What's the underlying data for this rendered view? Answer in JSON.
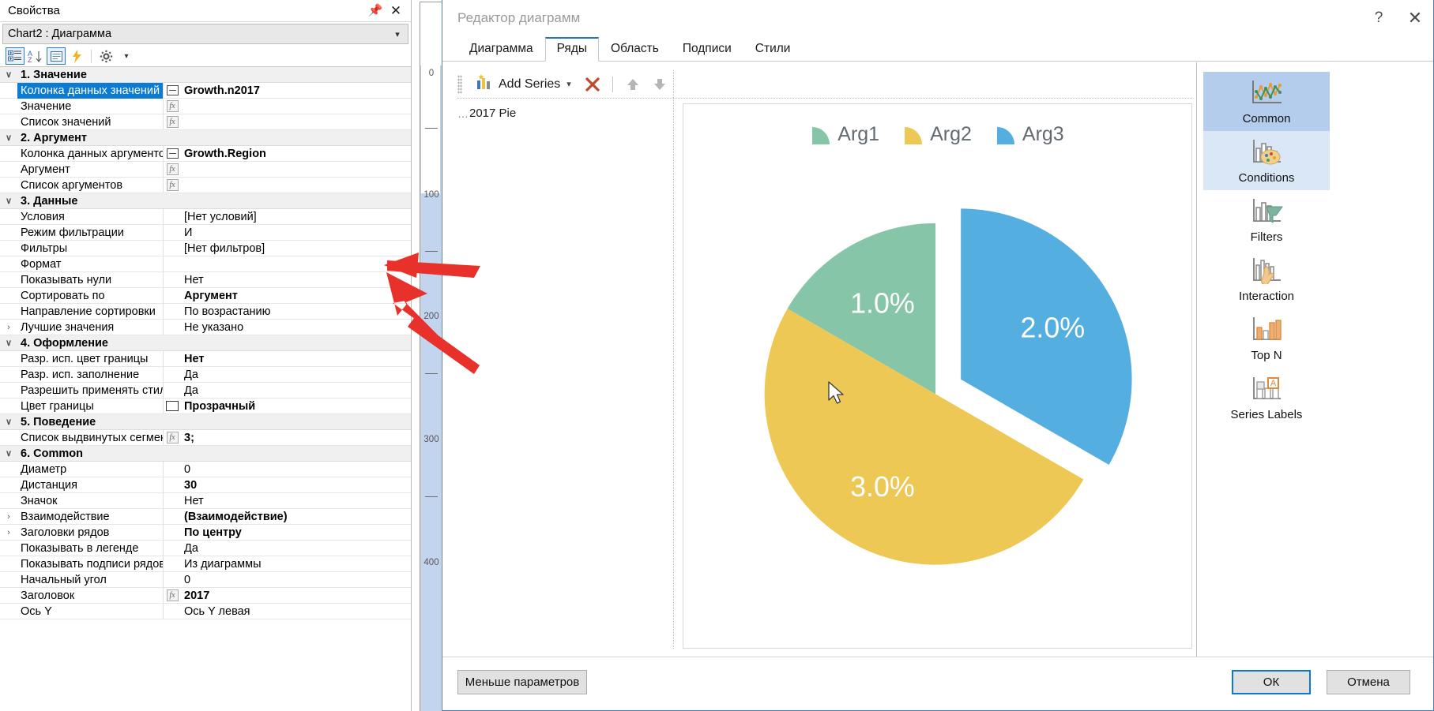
{
  "properties_panel": {
    "title": "Свойства",
    "pin_icon": "pin-icon",
    "close_icon": "close-icon",
    "object_selector": "Chart2 : Диаграмма",
    "toolbar": {
      "categorized_icon": "categorized-view-icon",
      "alphabetical_icon": "alphabetical-sort-icon",
      "pages_icon": "property-pages-icon",
      "events_icon": "events-lightning-icon",
      "settings_icon": "gear-icon",
      "settings_dropdown_icon": "chevron-down-icon"
    },
    "rows": [
      {
        "type": "group",
        "twisty": "v",
        "name": "1. Значение"
      },
      {
        "type": "prop",
        "twisty": "",
        "name": "Колонка данных значений",
        "badge": "column",
        "value": "Growth.n2017",
        "bold": true,
        "selected": true
      },
      {
        "type": "prop",
        "twisty": "",
        "name": "Значение",
        "badge": "fx",
        "value": "",
        "bold": false
      },
      {
        "type": "prop",
        "twisty": "",
        "name": "Список значений",
        "badge": "fx",
        "value": "",
        "bold": false
      },
      {
        "type": "group",
        "twisty": "v",
        "name": "2. Аргумент"
      },
      {
        "type": "prop",
        "twisty": "",
        "name": "Колонка данных аргументо",
        "badge": "column",
        "value": "Growth.Region",
        "bold": true
      },
      {
        "type": "prop",
        "twisty": "",
        "name": "Аргумент",
        "badge": "fx",
        "value": "",
        "bold": false
      },
      {
        "type": "prop",
        "twisty": "",
        "name": "Список аргументов",
        "badge": "fx",
        "value": "",
        "bold": false
      },
      {
        "type": "group",
        "twisty": "v",
        "name": "3. Данные"
      },
      {
        "type": "prop",
        "twisty": "",
        "name": "Условия",
        "badge": "",
        "value": "[Нет условий]",
        "bold": false
      },
      {
        "type": "prop",
        "twisty": "",
        "name": "Режим фильтрации",
        "badge": "",
        "value": "И",
        "bold": false
      },
      {
        "type": "prop",
        "twisty": "",
        "name": "Фильтры",
        "badge": "",
        "value": "[Нет фильтров]",
        "bold": false
      },
      {
        "type": "prop",
        "twisty": "",
        "name": "Формат",
        "badge": "",
        "value": "",
        "bold": false
      },
      {
        "type": "prop",
        "twisty": "",
        "name": "Показывать нули",
        "badge": "",
        "value": "Нет",
        "bold": false
      },
      {
        "type": "prop",
        "twisty": "",
        "name": "Сортировать по",
        "badge": "",
        "value": "Аргумент",
        "bold": true
      },
      {
        "type": "prop",
        "twisty": "",
        "name": "Направление сортировки",
        "badge": "",
        "value": "По возрастанию",
        "bold": false
      },
      {
        "type": "prop",
        "twisty": ">",
        "name": "Лучшие значения",
        "badge": "",
        "value": "Не указано",
        "bold": false
      },
      {
        "type": "group",
        "twisty": "v",
        "name": "4. Оформление"
      },
      {
        "type": "prop",
        "twisty": "",
        "name": "Разр. исп. цвет границы",
        "badge": "",
        "value": "Нет",
        "bold": true
      },
      {
        "type": "prop",
        "twisty": "",
        "name": "Разр. исп. заполнение",
        "badge": "",
        "value": "Да",
        "bold": false
      },
      {
        "type": "prop",
        "twisty": "",
        "name": "Разрешить применять стил",
        "badge": "",
        "value": "Да",
        "bold": false
      },
      {
        "type": "prop",
        "twisty": "",
        "name": "Цвет границы",
        "badge": "swatch",
        "value": "Прозрачный",
        "bold": true
      },
      {
        "type": "group",
        "twisty": "v",
        "name": "5. Поведение"
      },
      {
        "type": "prop",
        "twisty": "",
        "name": "Список выдвинутых сегмен",
        "badge": "fx",
        "value": "3;",
        "bold": true
      },
      {
        "type": "group",
        "twisty": "v",
        "name": "6. Common"
      },
      {
        "type": "prop",
        "twisty": "",
        "name": "Диаметр",
        "badge": "",
        "value": "0",
        "bold": false
      },
      {
        "type": "prop",
        "twisty": "",
        "name": "Дистанция",
        "badge": "",
        "value": "30",
        "bold": true
      },
      {
        "type": "prop",
        "twisty": "",
        "name": "Значок",
        "badge": "",
        "value": "Нет",
        "bold": false
      },
      {
        "type": "prop",
        "twisty": ">",
        "name": "Взаимодействие",
        "badge": "",
        "value": "(Взаимодействие)",
        "bold": true
      },
      {
        "type": "prop",
        "twisty": ">",
        "name": "Заголовки рядов",
        "badge": "",
        "value": "По центру",
        "bold": true
      },
      {
        "type": "prop",
        "twisty": "",
        "name": "Показывать в легенде",
        "badge": "",
        "value": "Да",
        "bold": false
      },
      {
        "type": "prop",
        "twisty": "",
        "name": "Показывать подписи рядов",
        "badge": "",
        "value": "Из диаграммы",
        "bold": false
      },
      {
        "type": "prop",
        "twisty": "",
        "name": "Начальный угол",
        "badge": "",
        "value": "0",
        "bold": false
      },
      {
        "type": "prop",
        "twisty": "",
        "name": "Заголовок",
        "badge": "fx",
        "value": "2017",
        "bold": true
      },
      {
        "type": "prop",
        "twisty": "",
        "name": "Ось Y",
        "badge": "",
        "value": "Ось Y левая",
        "bold": false
      }
    ]
  },
  "ruler": {
    "ticks": [
      "0",
      "100",
      "200",
      "300",
      "400"
    ]
  },
  "dialog": {
    "title": "Редактор диаграмм",
    "help_icon": "help-question-icon",
    "close_icon": "close-icon",
    "tabs": [
      {
        "label": "Диаграмма",
        "active": false
      },
      {
        "label": "Ряды",
        "active": true
      },
      {
        "label": "Область",
        "active": false
      },
      {
        "label": "Подписи",
        "active": false
      },
      {
        "label": "Стили",
        "active": false
      }
    ],
    "series_toolbar": {
      "add_series_label": "Add Series",
      "add_series_icon": "add-series-chart-icon",
      "add_series_dropdown_icon": "chevron-down-icon",
      "delete_icon": "delete-x-icon",
      "move_up_icon": "arrow-up-icon",
      "move_down_icon": "arrow-down-icon"
    },
    "series_tree": [
      {
        "label": "2017 Pie"
      }
    ],
    "rail": [
      {
        "label": "Common",
        "icon": "line-chart-icon",
        "state": "selected"
      },
      {
        "label": "Conditions",
        "icon": "palette-chart-icon",
        "state": "highlight"
      },
      {
        "label": "Filters",
        "icon": "funnel-chart-icon",
        "state": "normal"
      },
      {
        "label": "Interaction",
        "icon": "hand-chart-icon",
        "state": "normal"
      },
      {
        "label": "Top N",
        "icon": "topn-bars-icon",
        "state": "normal"
      },
      {
        "label": "Series Labels",
        "icon": "series-labels-icon",
        "state": "normal"
      }
    ],
    "footer": {
      "less_params": "Меньше параметров",
      "ok": "ОК",
      "cancel": "Отмена"
    }
  },
  "chart_data": {
    "type": "pie",
    "title": "",
    "categories": [
      "Arg1",
      "Arg2",
      "Arg3"
    ],
    "values": [
      1.0,
      3.0,
      2.0
    ],
    "data_labels": [
      "1.0%",
      "3.0%",
      "2.0%"
    ],
    "colors": [
      "#86c5a7",
      "#edc854",
      "#54aee0"
    ],
    "legend": {
      "position": "top",
      "entries": [
        "Arg1",
        "Arg2",
        "Arg3"
      ]
    },
    "exploded_slices": [
      3
    ],
    "explode_distance": 30,
    "start_angle": 0,
    "grid": false
  }
}
